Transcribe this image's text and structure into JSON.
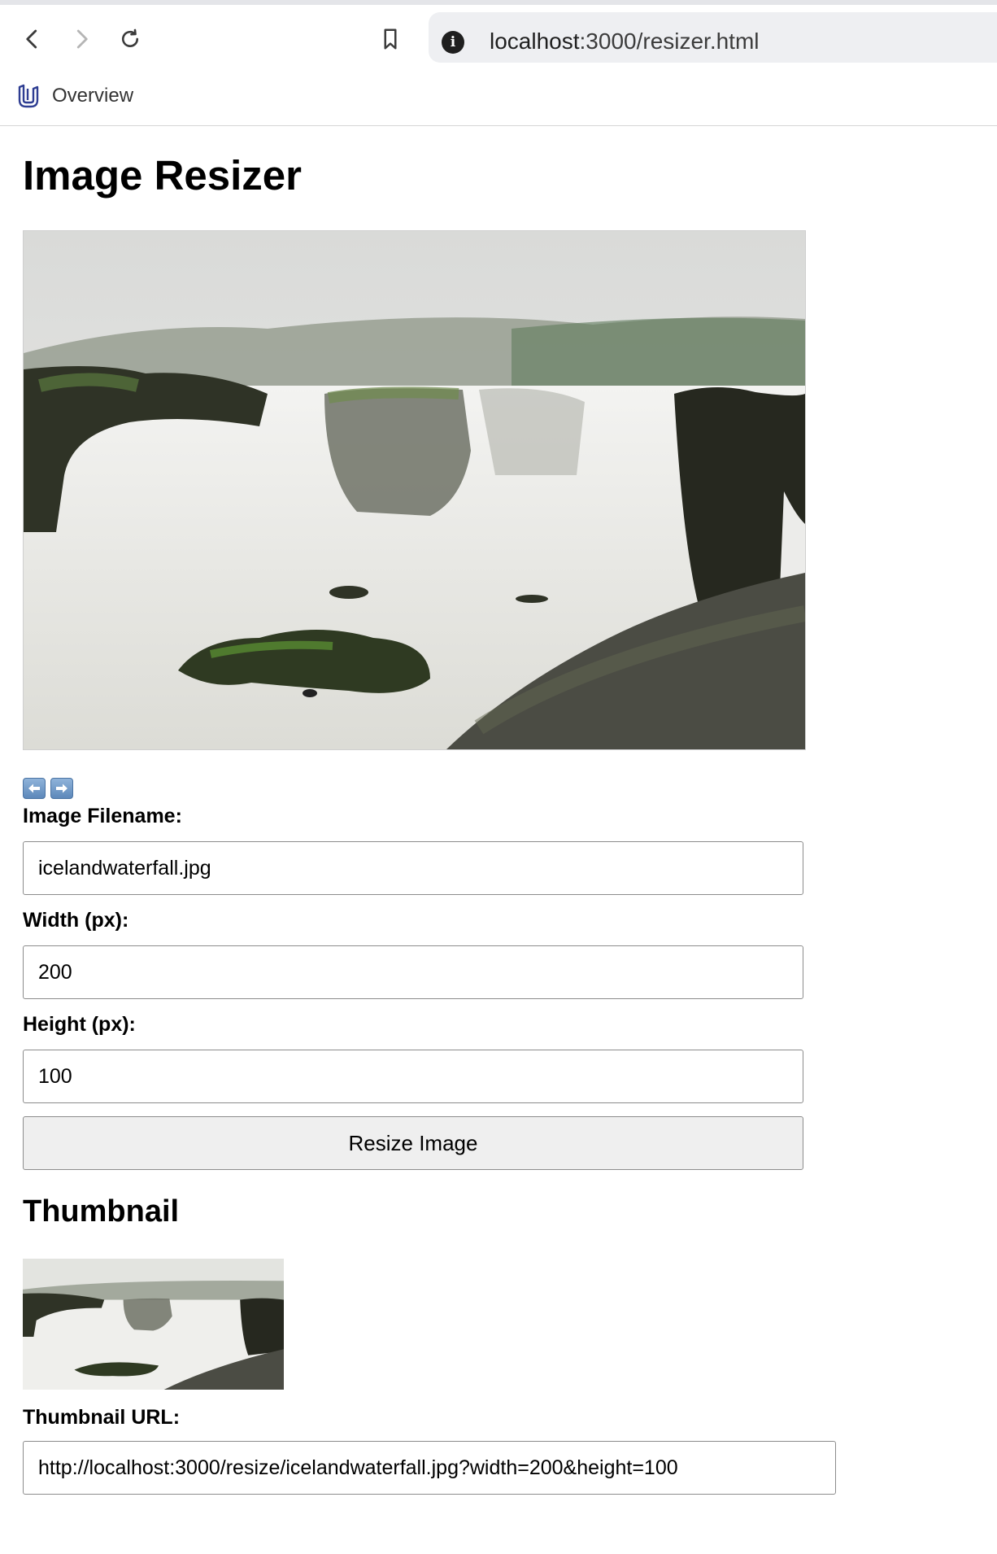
{
  "browser": {
    "url_host": "localhost",
    "url_rest": ":3000/resizer.html",
    "info_icon_glyph": "i",
    "icons": [
      "back-icon",
      "forward-icon",
      "reload-icon",
      "bookmark-icon",
      "site-info-icon"
    ],
    "bookmark_bar": {
      "items": [
        {
          "label": "Overview",
          "icon": "udacity-logo-icon"
        }
      ]
    }
  },
  "page": {
    "title": "Image Resizer",
    "image_alt": "Iceland waterfall",
    "nav_icons": [
      "previous-arrow-icon",
      "next-arrow-icon"
    ],
    "form": {
      "filename_label": "Image Filename:",
      "filename_value": "icelandwaterfall.jpg",
      "width_label": "Width (px):",
      "width_value": "200",
      "height_label": "Height (px):",
      "height_value": "100",
      "submit_label": "Resize Image"
    },
    "thumbnail_heading": "Thumbnail",
    "thumbnail_url_label": "Thumbnail URL:",
    "thumbnail_url_value": "http://localhost:3000/resize/icelandwaterfall.jpg?width=200&height=100"
  },
  "colors": {
    "accent_logo": "#2e3d92",
    "arrow_blue": "#5d88ba"
  }
}
